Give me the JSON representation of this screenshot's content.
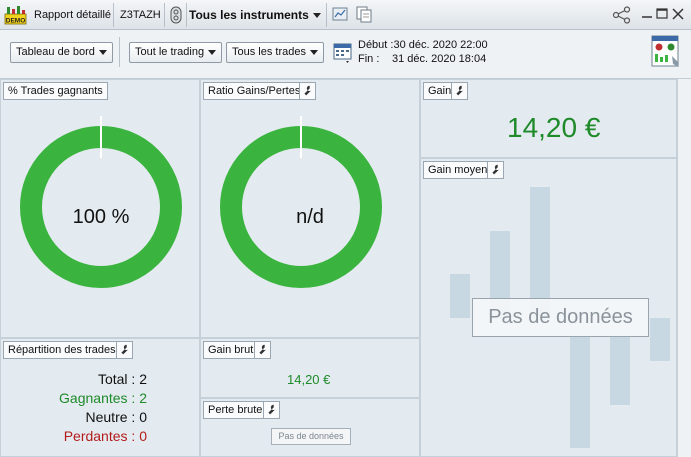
{
  "titlebar": {
    "demo_badge": "DEMO",
    "report": "Rapport détaillé",
    "account": "Z3TAZH",
    "instrument": "Tous les instruments"
  },
  "toolbar": {
    "dashboard": "Tableau de bord",
    "trading": "Tout le trading",
    "trades": "Tous les trades",
    "start_label": "Début :",
    "start_value": "30 déc. 2020 22:00",
    "end_label": "Fin :",
    "end_value": "31 déc. 2020 18:04"
  },
  "panels": {
    "win_pct": {
      "title": "% Trades gagnants",
      "value": "100 %",
      "win_fraction": 1.0
    },
    "ratio": {
      "title": "Ratio Gains/Pertes",
      "value": "n/d"
    },
    "gain": {
      "title": "Gain",
      "value": "14,20 €"
    },
    "avg_gain": {
      "title": "Gain moyen",
      "no_data": "Pas de données"
    },
    "distribution": {
      "title": "Répartition des trades",
      "total_label": "Total :",
      "total": "2",
      "win_label": "Gagnantes :",
      "win": "2",
      "neutral_label": "Neutre :",
      "neutral": "0",
      "lose_label": "Perdantes :",
      "lose": "0"
    },
    "gross_gain": {
      "title": "Gain brut",
      "value": "14,20 €"
    },
    "gross_loss": {
      "title": "Perte brute",
      "no_data": "Pas de données"
    }
  },
  "colors": {
    "donut": "#3bb33f",
    "green_text": "#1e8a2a",
    "red_text": "#b31b1b",
    "panel_bg": "#e4ebf0"
  }
}
